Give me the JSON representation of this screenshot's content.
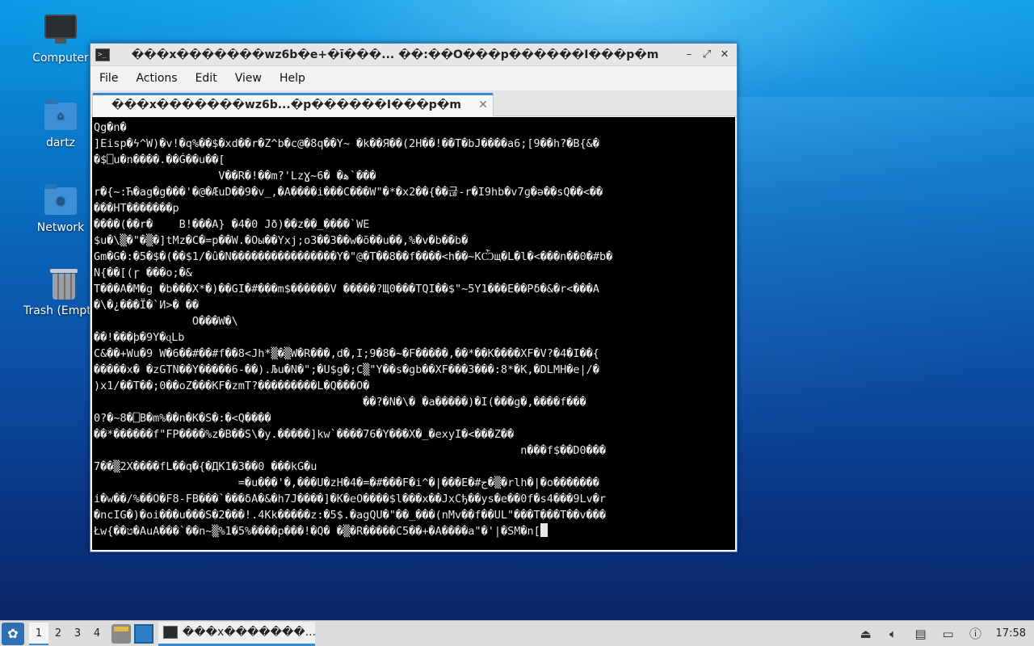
{
  "desktop": {
    "icons": [
      {
        "label": "Computer",
        "icon": "computer-icon"
      },
      {
        "label": "dartz",
        "icon": "home-folder-icon"
      },
      {
        "label": "Network",
        "icon": "network-folder-icon"
      },
      {
        "label": "Trash (Empty)",
        "icon": "trash-icon"
      }
    ]
  },
  "window": {
    "title": "���x�������wz6b�e+�ī���... ��:��O���p������I���p�m",
    "controls": {
      "minimize": "–",
      "maximize": "⤢",
      "close": "✕"
    },
    "menu": [
      "File",
      "Actions",
      "Edit",
      "View",
      "Help"
    ],
    "tab": {
      "label": "���x�������wz6b...�p������I���p�m",
      "close": "✕"
    },
    "terminal_lines": [
      "Qg�n�",
      "]Eisp�ϟ^W)�v!�q%��$�xd��r�Z^b�c@�8q��Y~ �k��Я��(2H��!��T�bJ����a6;[9��h?�B{&�",
      "�$⎕u�n����.��Ǵ��u��[",
      "                   V��R�!��m?'LzƔ~6� �ﻫ`���",
      "r�{~:Ћ�ag�g���'�@�ÆuD��9�v_,�A����i���C���W\"�*�x2��{��귾-r�I9hb�v7ɡ�ə��sQ��<��",
      "���HT�������p",
      "����(��r�    B!���A} �4�0 Jð)��z��_����`WE",
      "$u�\\▒�\"�▒�]tMz�C�=p��W.�Oы��Yxj;o3��3��w�ō��u��,%�v�b��b�",
      "Gm�G�:�5�$�(��$1/�û�N����������������Y�\"@�T��8��f����<h��~KѼщ�L�l�<���n��0�#b�",
      "N{��[(ɼ ���o;�&",
      "T���A�M�g �b���X*�)��GI�#���m$������V �����?Щ0���TQI��$\"~5Y1���E��Pδ�&�r<���A",
      "�\\�¿���Ï�`И>� ��",
      "               O���W�\\",
      "��!���þ�9Y�ɋLb",
      "C&��+Wu�9 W�6��#��#f��8<Jh*▒�▒W�R���,d�,I;9�8�~�F�����,��*��K����XF�V?�4�I��{",
      "�����x� �zGTN��Y�����6-��).Љu�N�\";�U$g�;C▒\"Y��s�gb��XF���3���:8*�K,�DLMH�e|/�",
      ")x1/��T��;0��oZ���KF�zmT?���������L�Q���O�",
      "                                         ��?�N�\\� �a�����)�I(���g�,����f���",
      "0?�~8�⎕B�m%��n�K�S�:�<Q����",
      "��*������f\"FP����%z�B��S\\�y.�����]kw`����76�Y���X�_�exyI�<���Z��",
      "                                                                 n���f$��D0���",
      "7��▒2X����fL��q�{�ДK1�3��0 ���kG�u",
      "                      =�u���'�,���U�zH�4�=�#���F�i^�|���E�#ج�▒�rlh�|�o�������",
      "i�w��/%��O�F8-FB���`���δA�&�h7J����]�K�eO����$l���x��JxCђ��ys�e��0f�s4���9Lv�r",
      "�ncIG�)�oi���u���S�2���!.4Kk�����z:�5$.�agQU�\"��_���(nMv��f��UL\"���T���T��v���",
      "Łw{��ט�AuA���`��n~▒%1�5%����p���!�Q� �▒�R�����C5��+�A����a\"�'|�SM�n["
    ]
  },
  "taskbar": {
    "start": "✿",
    "workspaces": [
      "1",
      "2",
      "3",
      "4"
    ],
    "active_workspace": "1",
    "task_title": "���x�������...",
    "clock": "17:58",
    "tray_icons": [
      "eject-icon",
      "volume-icon",
      "clipboard-icon",
      "network-tray-icon",
      "update-notifier-icon"
    ]
  }
}
